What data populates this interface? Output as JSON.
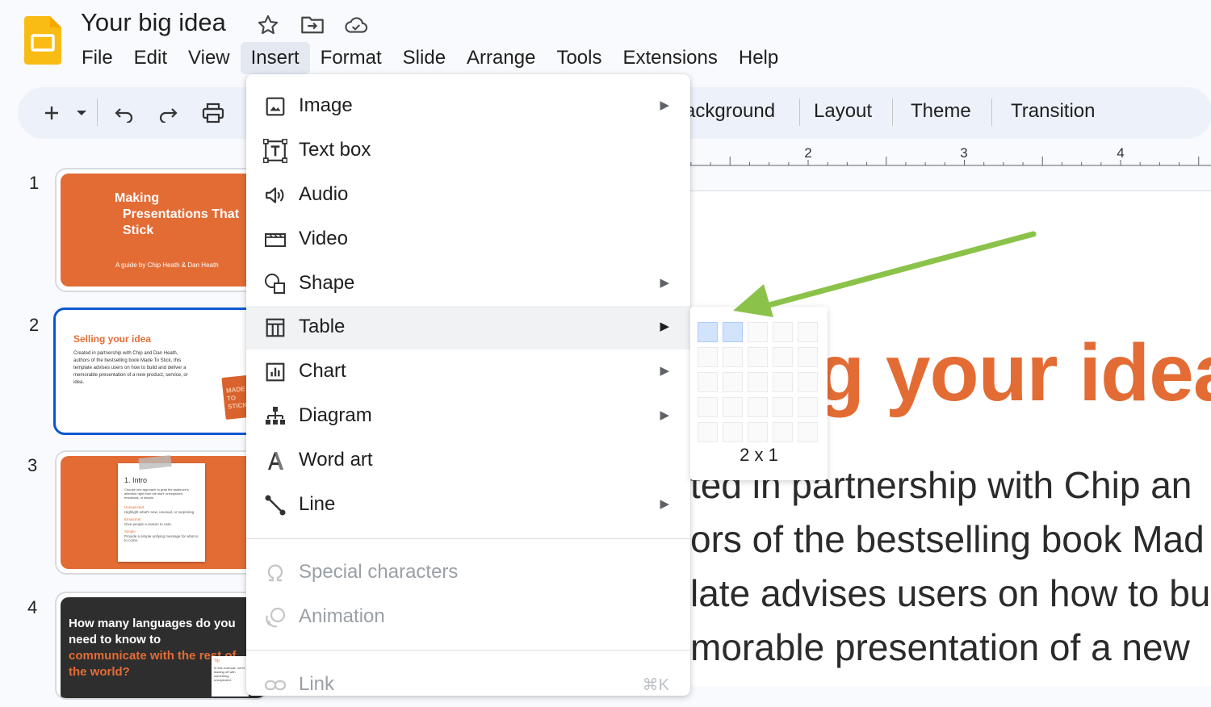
{
  "document": {
    "title": "Your big idea"
  },
  "menubar": [
    "File",
    "Edit",
    "View",
    "Insert",
    "Format",
    "Slide",
    "Arrange",
    "Tools",
    "Extensions",
    "Help"
  ],
  "menubar_active": "Insert",
  "toolbar": {
    "background_label": "ackground",
    "layout_label": "Layout",
    "theme_label": "Theme",
    "transition_label": "Transition"
  },
  "ruler": {
    "ticks": [
      "2",
      "3",
      "4"
    ]
  },
  "slides": [
    {
      "number": "1",
      "title_lines": [
        "Making",
        "Presentations That",
        "Stick"
      ],
      "subtitle": "A guide by Chip Heath & Dan Heath"
    },
    {
      "number": "2",
      "title": "Selling your idea",
      "body": "Created in partnership with Chip and Dan Heath, authors of the bestselling book Made To Stick, this template advises users on how to build and deliver a memorable presentation of a new product, service, or idea.",
      "book_text": "MADE TO STICK"
    },
    {
      "number": "3",
      "heading": "1. Intro",
      "intro": "Choose one approach to grab the audience's attention right from the start: unexpected, emotional, or simple.",
      "points": [
        {
          "label": "Unexpected",
          "text": "Highlight what's new, unusual, or surprising."
        },
        {
          "label": "Emotional",
          "text": "Give people a reason to care."
        },
        {
          "label": "Simple",
          "text": "Provide a simple unifying message for what is to come."
        }
      ]
    },
    {
      "number": "4",
      "title_white": "How many languages do you need to know to",
      "title_orange": "communicate with the rest of the world?",
      "tip_label": "Tip",
      "tip_text": "In this example, we're leading off with something unexpected."
    }
  ],
  "slide_main": {
    "title_fragment": "g your idea",
    "body_lines": [
      "ted in partnership with Chip an",
      "ors of the bestselling book Mad",
      "late advises users on how to bu",
      "morable presentation of a new"
    ]
  },
  "insert_menu": {
    "items": [
      {
        "label": "Image",
        "icon": "image-icon",
        "submenu": true
      },
      {
        "label": "Text box",
        "icon": "text-box-icon",
        "submenu": false
      },
      {
        "label": "Audio",
        "icon": "audio-icon",
        "submenu": false
      },
      {
        "label": "Video",
        "icon": "video-icon",
        "submenu": false
      },
      {
        "label": "Shape",
        "icon": "shape-icon",
        "submenu": true
      },
      {
        "label": "Table",
        "icon": "table-icon",
        "submenu": true
      },
      {
        "label": "Chart",
        "icon": "chart-icon",
        "submenu": true
      },
      {
        "label": "Diagram",
        "icon": "diagram-icon",
        "submenu": true
      },
      {
        "label": "Word art",
        "icon": "word-art-icon",
        "submenu": false
      },
      {
        "label": "Line",
        "icon": "line-icon",
        "submenu": true
      }
    ],
    "disabled_items": [
      {
        "label": "Special characters",
        "icon": "omega-icon"
      },
      {
        "label": "Animation",
        "icon": "animation-icon"
      }
    ],
    "link_item": {
      "label": "Link",
      "shortcut": "⌘K",
      "icon": "link-icon"
    },
    "hovered": "Table",
    "arrow_glyph": "▶"
  },
  "table_picker": {
    "columns": 5,
    "rows": 5,
    "selected_columns": 2,
    "selected_rows": 1,
    "label": "2 x 1"
  },
  "colors": {
    "accent_orange": "#e36c35",
    "selection_blue": "#0b57d0",
    "arrow_green": "#8bc34a",
    "picker_highlight": "#d2e3fc"
  }
}
